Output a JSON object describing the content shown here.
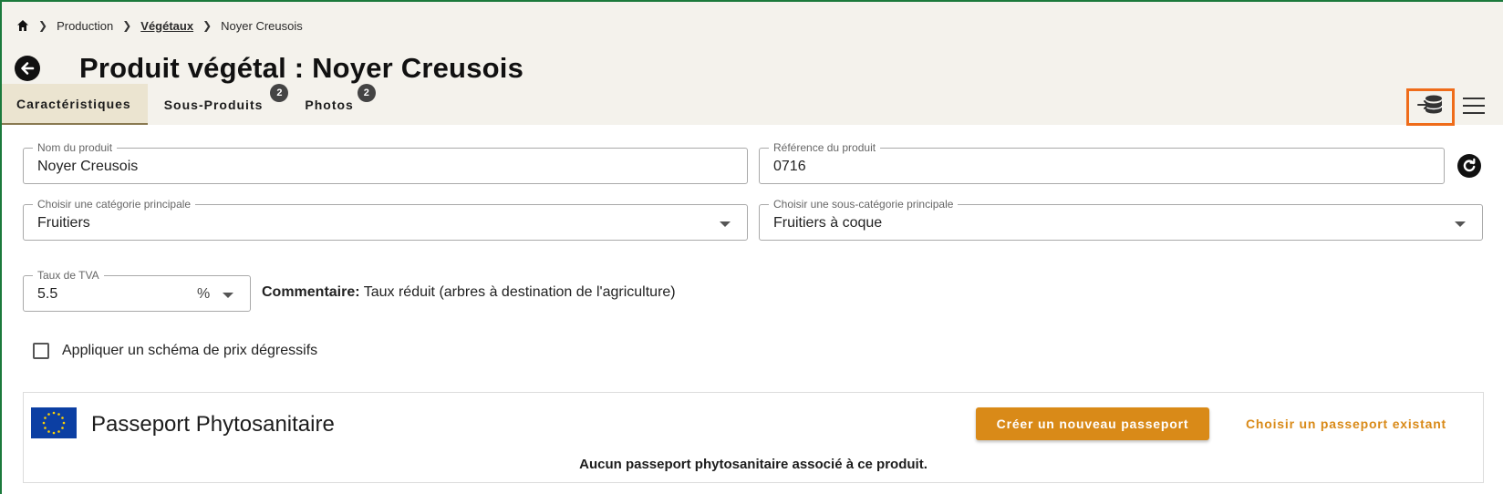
{
  "breadcrumb": {
    "home_icon": "home-icon",
    "items": [
      "Production",
      "Végétaux",
      "Noyer Creusois"
    ]
  },
  "page": {
    "title": "Produit végétal : Noyer Creusois",
    "back_icon": "arrow-left-circle-icon"
  },
  "tabs": [
    {
      "label": "Caractéristiques",
      "active": true
    },
    {
      "label": "Sous-Produits",
      "badge": "2"
    },
    {
      "label": "Photos",
      "badge": "2"
    }
  ],
  "toolbar": {
    "highlight_icon": "database-import-icon",
    "highlight_color": "#ef6c1a",
    "menu_icon": "hamburger-menu-icon"
  },
  "form": {
    "product_name": {
      "label": "Nom du produit",
      "value": "Noyer Creusois"
    },
    "product_ref": {
      "label": "Référence du produit",
      "value": "0716"
    },
    "main_category": {
      "label": "Choisir une catégorie principale",
      "value": "Fruitiers"
    },
    "sub_category": {
      "label": "Choisir une sous-catégorie principale",
      "value": "Fruitiers à coque"
    },
    "vat": {
      "label": "Taux de TVA",
      "value": "5.5",
      "unit": "%"
    },
    "comment_label": "Commentaire:",
    "comment_text": "Taux réduit (arbres à destination de l'agriculture)",
    "degressive_label": "Appliquer un schéma de prix dégressifs",
    "degressive_checked": false
  },
  "passport": {
    "title": "Passeport Phytosanitaire",
    "create_label": "Créer un nouveau passeport",
    "choose_label": "Choisir un passeport existant",
    "empty_text": "Aucun passeport phytosanitaire associé à ce produit.",
    "accent_color": "#d98a18"
  }
}
